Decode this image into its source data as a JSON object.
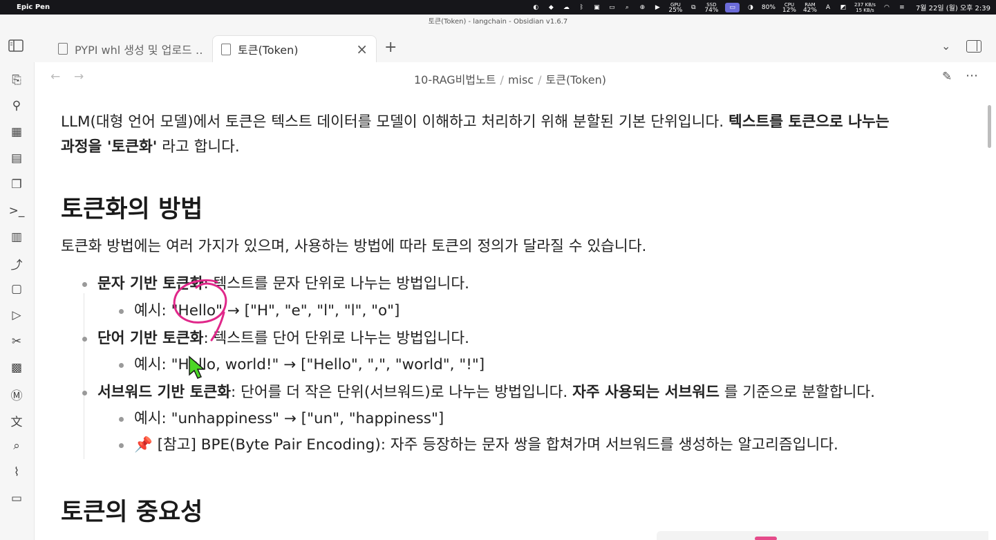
{
  "menubar": {
    "app_name": "Epic Pen",
    "gpu": "25%",
    "ssd": "74%",
    "battery": "80%",
    "cpu": "12%",
    "ram": "42%",
    "net_up": "237 KB/s",
    "net_down": "15 KB/s",
    "clock": "7월 22일 (월) 오후 2:39",
    "labels": {
      "gpu": "GPU",
      "ssd": "SSD",
      "cpu": "CPU",
      "ram": "RAM"
    }
  },
  "window": {
    "title": "토큰(Token) - langchain - Obsidian v1.6.7"
  },
  "tabs": [
    {
      "label": "PYPI whl 생성 및 업로드 …"
    },
    {
      "label": "토큰(Token)",
      "active": true
    }
  ],
  "breadcrumb": [
    "10-RAG비법노트",
    "misc",
    "토큰(Token)"
  ],
  "icons": {
    "ribbon": [
      "open-quick-switcher-icon",
      "graph-view-icon",
      "canvas-icon",
      "daily-note-icon",
      "templates-icon",
      "terminal-icon",
      "slides-icon",
      "git-icon",
      "chat-icon",
      "run-icon",
      "tools-icon",
      "kanban-icon",
      "copilot-icon",
      "translate-icon",
      "search-icon",
      "workflow-icon",
      "comment-icon"
    ]
  },
  "doc": {
    "intro_normal": "LLM(대형 언어 모델)에서 토큰은 텍스트 데이터를 모델이 이해하고 처리하기 위해 분할된 기본 단위입니다. ",
    "intro_bold1": "텍스트를 토큰으로 나누는",
    "intro_bold2": "과정을 '토큰화'",
    "intro_tail": " 라고 합니다.",
    "h_methods": "토큰화의 방법",
    "methods_desc": "토큰화 방법에는 여러 가지가 있으며, 사용하는 방법에 따라 토큰의 정의가 달라질 수 있습니다.",
    "items": [
      {
        "bold": "문자 기반 토큰화",
        "text": ": 텍스트를 문자 단위로 나누는 방법입니다.",
        "sub": [
          "예시: \"Hello\" → [\"H\", \"e\", \"l\", \"l\", \"o\"]"
        ]
      },
      {
        "bold": "단어 기반 토큰화",
        "text": ": 텍스트를 단어 단위로 나누는 방법입니다.",
        "sub": [
          "예시: \"Hello, world!\" → [\"Hello\", \",\", \"world\", \"!\"]"
        ]
      },
      {
        "bold": "서브워드 기반 토큰화",
        "text": ": 단어를 더 작은 단위(서브워드)로 나누는 방법입니다. ",
        "bold2": "자주 사용되는 서브워드",
        "text2": " 를 기준으로 분할합니다.",
        "sub": [
          "예시: \"unhappiness\" → [\"un\", \"happiness\"]",
          "📌 [참고] BPE(Byte Pair Encoding): 자주 등장하는 문자 쌍을 합쳐가며 서브워드를 생성하는 알고리즘입니다."
        ]
      }
    ],
    "h_importance": "토큰의 중요성"
  },
  "colors": {
    "annotation_pen": "#e0288a",
    "cursor": "#4cd626",
    "accent": "#7b6cd9"
  }
}
